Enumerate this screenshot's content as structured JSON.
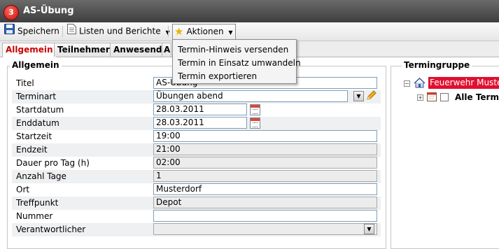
{
  "window": {
    "title": "AS-Übung",
    "app_icon": "app-logo-icon"
  },
  "toolbar": {
    "save_label": "Speichern",
    "lists_label": "Listen und Berichte",
    "actions_label": "Aktionen"
  },
  "tabs": [
    {
      "label": "Allgemein",
      "active": true
    },
    {
      "label": "Teilnehmer"
    },
    {
      "label": "Anwesend"
    },
    {
      "label": "A"
    }
  ],
  "actions_menu": {
    "items": [
      "Termin-Hinweis versenden",
      "Termin in Einsatz umwandeln",
      "Termin exportieren"
    ]
  },
  "general": {
    "legend": "Allgemein",
    "fields": [
      {
        "label": "Titel",
        "value": "AS-Übung"
      },
      {
        "label": "Terminart",
        "value": "Übungen abend"
      },
      {
        "label": "Startdatum",
        "value": "28.03.2011"
      },
      {
        "label": "Enddatum",
        "value": "28.03.2011"
      },
      {
        "label": "Startzeit",
        "value": "19:00"
      },
      {
        "label": "Endzeit",
        "value": "21:00"
      },
      {
        "label": "Dauer pro Tag (h)",
        "value": "02:00"
      },
      {
        "label": "Anzahl Tage",
        "value": "1"
      },
      {
        "label": "Ort",
        "value": "Musterdorf"
      },
      {
        "label": "Treffpunkt",
        "value": "Depot"
      },
      {
        "label": "Nummer",
        "value": ""
      },
      {
        "label": "Verantwortlicher",
        "value": ""
      }
    ]
  },
  "termingruppe": {
    "legend": "Termingruppe",
    "root": "Feuerwehr Musterdorf",
    "child": "Alle Termine"
  },
  "colors": {
    "accent_red": "#cc0000",
    "selection_red": "#e01030",
    "titlebar": "#4a4a4a"
  }
}
